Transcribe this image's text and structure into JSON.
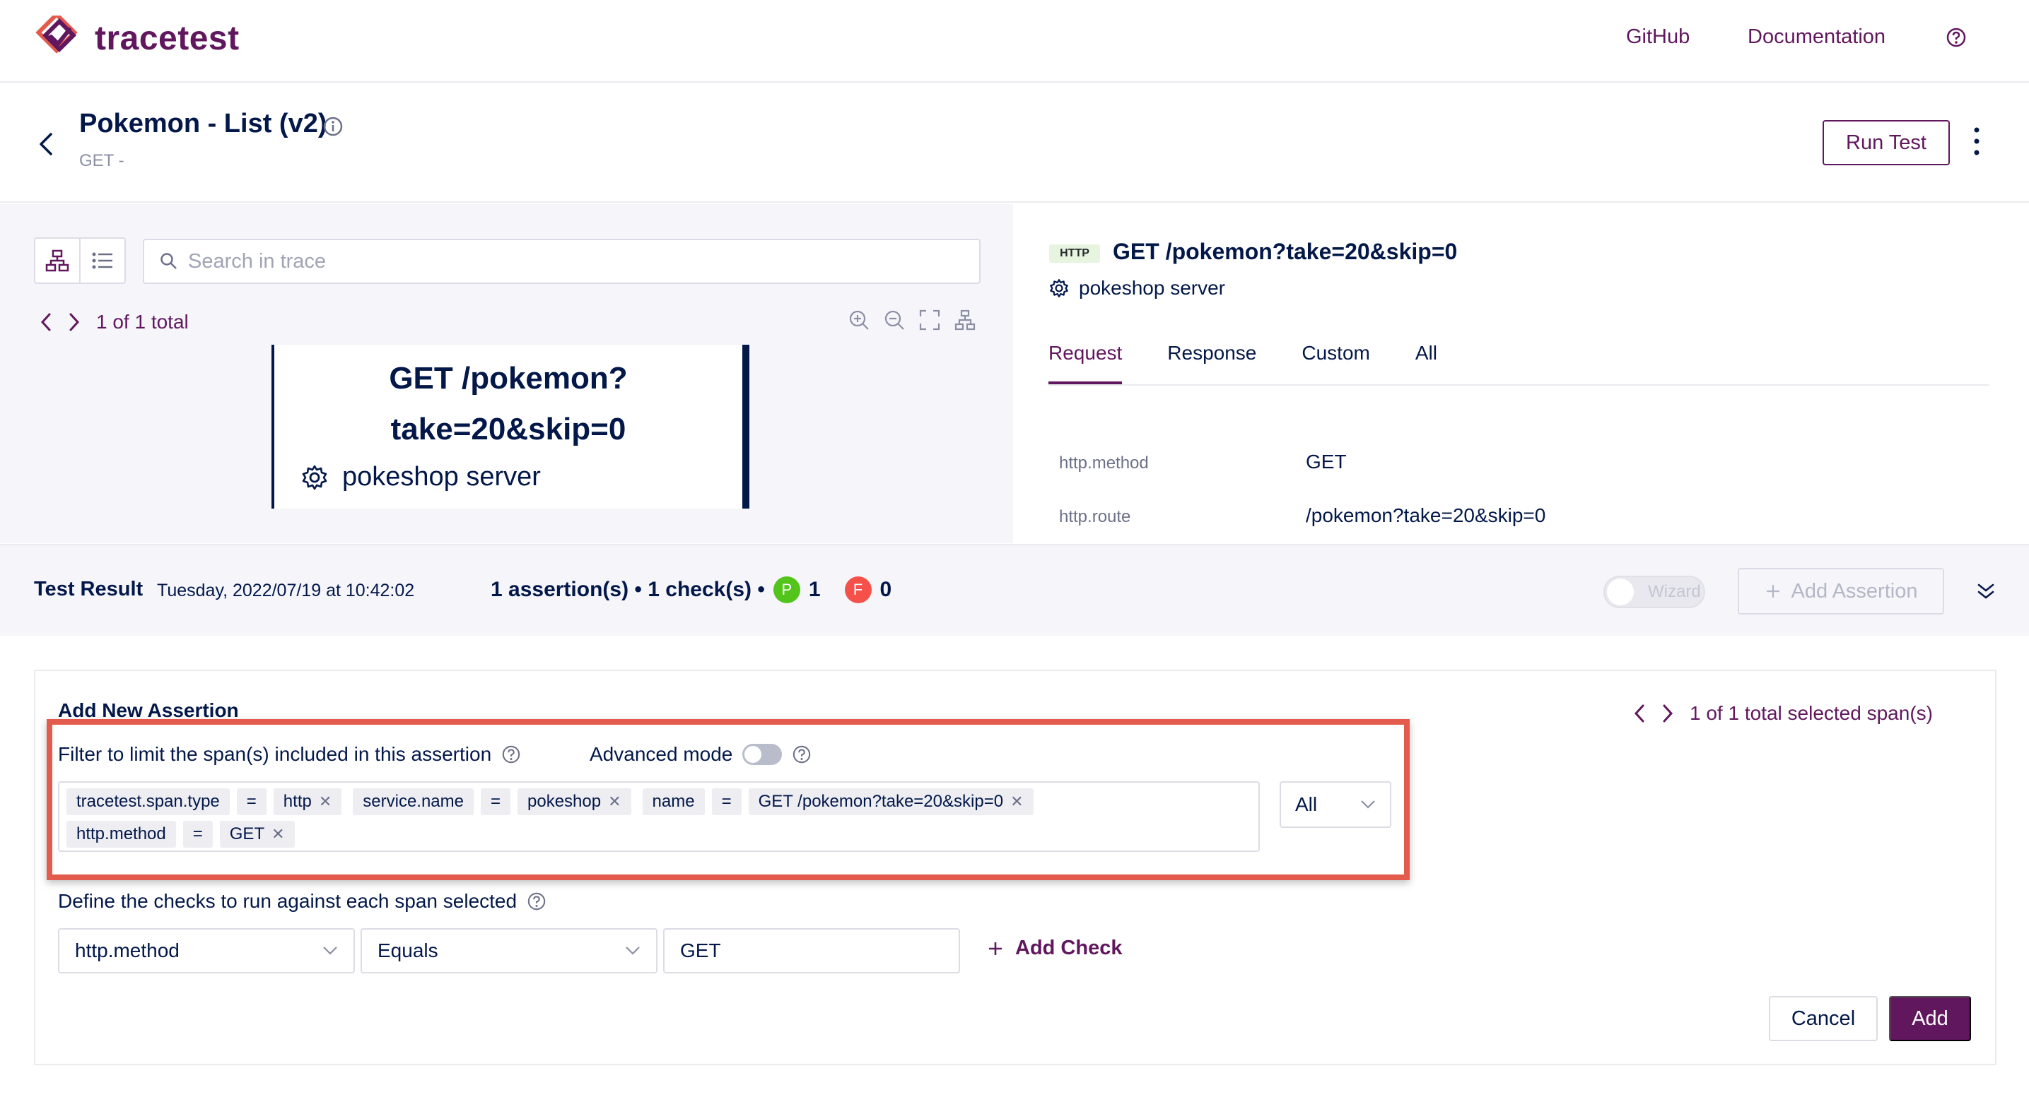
{
  "brand": {
    "name": "tracetest",
    "accent": "#61175e",
    "navy": "#031849"
  },
  "nav": {
    "github": "GitHub",
    "documentation": "Documentation",
    "help_icon": "question-circle-icon"
  },
  "header": {
    "title": "Pokemon - List (v2)",
    "subtitle": "GET -",
    "run_test": "Run Test"
  },
  "trace": {
    "search_placeholder": "Search in trace",
    "pager_text": "1 of 1 total",
    "node_title_line1": "GET /pokemon?",
    "node_title_line2": "take=20&skip=0",
    "node_service": "pokeshop server"
  },
  "span_detail": {
    "badge": "HTTP",
    "title": "GET /pokemon?take=20&skip=0",
    "service": "pokeshop server",
    "tabs": [
      "Request",
      "Response",
      "Custom",
      "All"
    ],
    "active_tab": "Request",
    "attributes": [
      {
        "key": "http.method",
        "value": "GET"
      },
      {
        "key": "http.route",
        "value": "/pokemon?take=20&skip=0"
      }
    ]
  },
  "result": {
    "title": "Test Result",
    "date": "Tuesday, 2022/07/19 at 10:42:02",
    "summary": "1 assertion(s) • 1 check(s) •",
    "pass_label": "P",
    "pass_count": "1",
    "fail_label": "F",
    "fail_count": "0",
    "pass_color": "#52c41a",
    "fail_color": "#f5504a",
    "wizard": "Wizard",
    "add_assertion": "Add Assertion"
  },
  "form": {
    "title": "Add New Assertion",
    "selected_pager": "1 of 1 total selected span(s)",
    "filter_label": "Filter to limit the span(s) included in this assertion",
    "advanced_mode": "Advanced mode",
    "filters": [
      {
        "key": "tracetest.span.type",
        "op": "=",
        "value": "http"
      },
      {
        "key": "service.name",
        "op": "=",
        "value": "pokeshop"
      },
      {
        "key": "name",
        "op": "=",
        "value": "GET /pokemon?take=20&skip=0"
      },
      {
        "key": "http.method",
        "op": "=",
        "value": "GET"
      }
    ],
    "scope": "All",
    "checks_label": "Define the checks to run against each span selected",
    "check_attribute": "http.method",
    "check_operator": "Equals",
    "check_value": "GET",
    "add_check": "Add Check",
    "cancel": "Cancel",
    "add": "Add",
    "highlight_color": "#e35b4d"
  }
}
